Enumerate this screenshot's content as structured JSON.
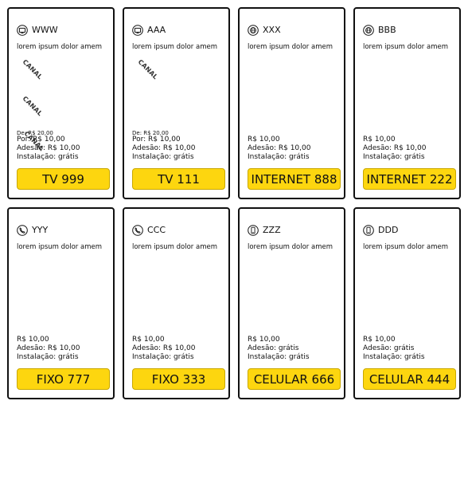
{
  "accent_color": "#FDD60F",
  "cards": [
    {
      "title": "WWW",
      "icon": "tv-icon",
      "desc": "lorem ipsum dolor amem",
      "canal": "CANAL",
      "de": "De: R$ 20,00",
      "price": "Por: R$ 10,00",
      "adesao": "Adesão: R$ 10,00",
      "instalacao": "Instalação: grátis",
      "button": "TV 999"
    },
    {
      "title": "AAA",
      "icon": "tv-icon",
      "desc": "lorem ipsum dolor amem",
      "canal": "CANAL",
      "de": "De: R$ 20,00",
      "price": "Por: R$ 10,00",
      "adesao": "Adesão: R$ 10,00",
      "instalacao": "Instalação: grátis",
      "button": "TV 111"
    },
    {
      "title": "XXX",
      "icon": "globe-icon",
      "desc": "lorem ipsum dolor amem",
      "price": "R$ 10,00",
      "adesao": "Adesão: R$ 10,00",
      "instalacao": "Instalação: grátis",
      "button": "INTERNET 888"
    },
    {
      "title": "BBB",
      "icon": "globe-icon",
      "desc": "lorem ipsum dolor amem",
      "price": "R$ 10,00",
      "adesao": "Adesão: R$ 10,00",
      "instalacao": "Instalação: grátis",
      "button": "INTERNET 222"
    },
    {
      "title": "YYY",
      "icon": "phone-icon",
      "desc": "lorem ipsum dolor amem",
      "price": "R$ 10,00",
      "adesao": "Adesão: R$ 10,00",
      "instalacao": "Instalação: grátis",
      "button": "FIXO 777"
    },
    {
      "title": "CCC",
      "icon": "phone-icon",
      "desc": "lorem ipsum dolor amem",
      "price": "R$ 10,00",
      "adesao": "Adesão: R$ 10,00",
      "instalacao": "Instalação: grátis",
      "button": "FIXO 333"
    },
    {
      "title": "ZZZ",
      "icon": "mobile-icon",
      "desc": "lorem ipsum dolor amem",
      "price": "R$ 10,00",
      "adesao": "Adesão: grátis",
      "instalacao": "Instalação: grátis",
      "button": "CELULAR 666"
    },
    {
      "title": "DDD",
      "icon": "mobile-icon",
      "desc": "lorem ipsum dolor amem",
      "price": "R$ 10,00",
      "adesao": "Adesão: grátis",
      "instalacao": "Instalação: grátis",
      "button": "CELULAR 444"
    }
  ]
}
